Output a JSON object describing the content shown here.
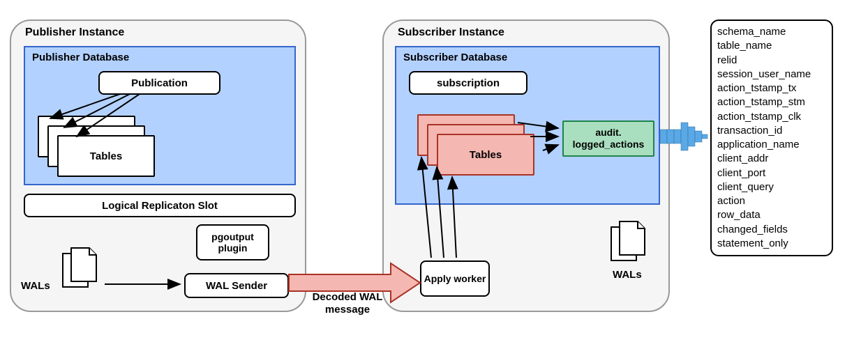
{
  "publisher": {
    "instance_title": "Publisher Instance",
    "database_title": "Publisher Database",
    "publication_label": "Publication",
    "tables_label": "Tables",
    "replication_slot_label": "Logical Replicaton Slot",
    "pgoutput_label": "pgoutput plugin",
    "wal_sender_label": "WAL Sender",
    "wals_label": "WALs"
  },
  "subscriber": {
    "instance_title": "Subscriber Instance",
    "database_title": "Subscriber Database",
    "subscription_label": "subscription",
    "tables_label": "Tables",
    "audit_label": "audit. logged_actions",
    "apply_worker_label": "Apply worker",
    "wals_label": "WALs"
  },
  "connector": {
    "decoded_wal_label": "Decoded WAL message"
  },
  "fields": [
    "schema_name",
    "table_name",
    "relid",
    "session_user_name",
    "action_tstamp_tx",
    "action_tstamp_stm",
    "action_tstamp_clk",
    "transaction_id",
    "application_name",
    "client_addr",
    "client_port",
    "client_query",
    "action",
    "row_data",
    "changed_fields",
    "statement_only"
  ]
}
